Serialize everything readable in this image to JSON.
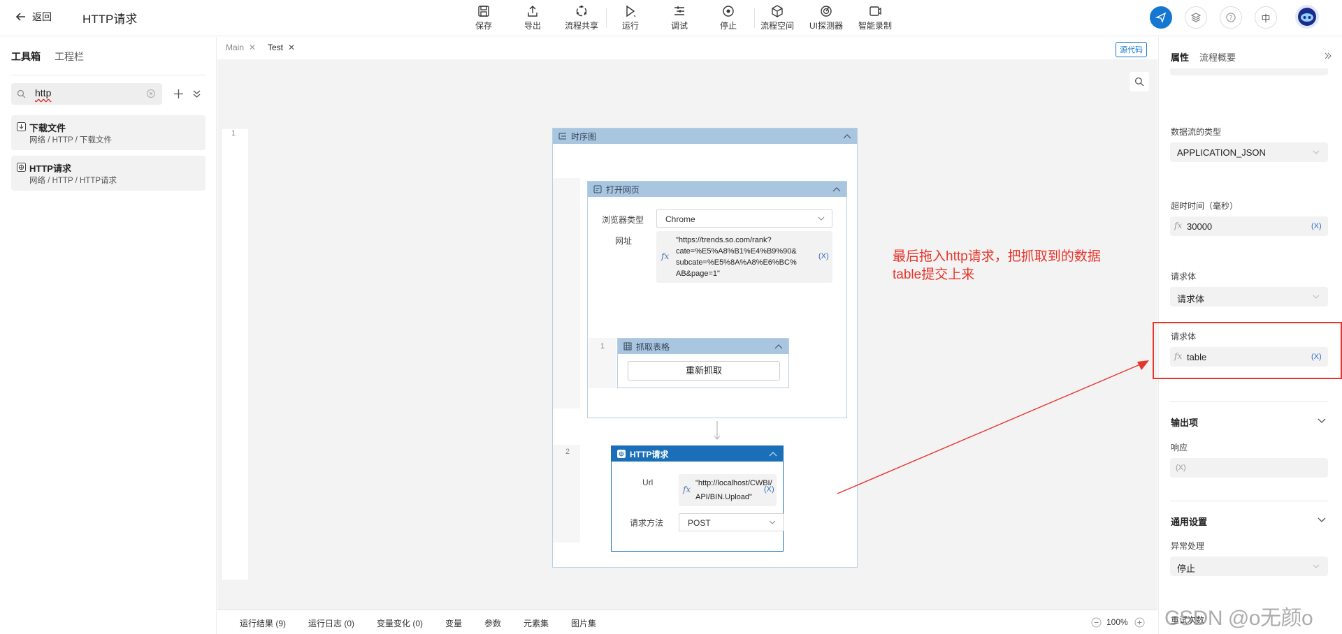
{
  "header": {
    "back_label": "返回",
    "page_title": "HTTP请求",
    "toolbar": [
      "保存",
      "导出",
      "流程共享",
      "运行",
      "调试",
      "停止",
      "流程空间",
      "UI探测器",
      "智能录制"
    ],
    "lang": "中"
  },
  "left": {
    "tabs": [
      "工具箱",
      "工程栏"
    ],
    "search_value": "http",
    "results": [
      {
        "title": "下载文件",
        "path": "网络 / HTTP / 下载文件"
      },
      {
        "title": "HTTP请求",
        "path": "网络 / HTTP / HTTP请求"
      }
    ]
  },
  "editor": {
    "tabs": [
      "Main",
      "Test"
    ],
    "source_btn": "源代码",
    "line_numbers": [
      "1",
      "1",
      "1",
      "2"
    ]
  },
  "flow": {
    "seq_title": "时序图",
    "open_title": "打开网页",
    "browser_label": "浏览器类型",
    "browser_value": "Chrome",
    "url_label": "网址",
    "url_lines": [
      "\"https://trends.so.com/rank?",
      "cate=%E5%A8%B1%E4%B9%90&",
      "subcate=%E5%8A%A8%E6%BC%",
      "AB&page=1\""
    ],
    "scrape_title": "抓取表格",
    "rescrape_btn": "重新抓取",
    "http_title": "HTTP请求",
    "http_url_label": "Url",
    "http_url_lines": [
      "\"http://localhost/CWBI/",
      "API/BIN.Upload\""
    ],
    "method_label": "请求方法",
    "method_value": "POST",
    "x_token": "(X)"
  },
  "annotation": {
    "line1": "最后拖入http请求，把抓取到的数据",
    "line2": "table提交上来",
    "color": "#e8352b"
  },
  "bottom": {
    "tabs": [
      "运行结果 (9)",
      "运行日志 (0)",
      "变量变化 (0)",
      "变量",
      "参数",
      "元素集",
      "图片集"
    ],
    "zoom": "100%"
  },
  "right": {
    "tabs": [
      "属性",
      "流程概要"
    ],
    "dataflow_label": "数据流的类型",
    "dataflow_value": "APPLICATION_JSON",
    "timeout_label": "超时时间（毫秒）",
    "timeout_value": "30000",
    "body_label": "请求体",
    "body_select": "请求体",
    "body_label2": "请求体",
    "body_value": "table",
    "output_section": "输出项",
    "response_label": "响应",
    "general_section": "通用设置",
    "exception_label": "异常处理",
    "exception_value": "停止",
    "retry_label": "重试次数"
  },
  "watermark": "CSDN @o无颜o",
  "colors": {
    "accent": "#1677d2",
    "http_header": "#1a6fb8",
    "seq_header": "#a9c6e1",
    "annotation": "#e8352b"
  }
}
